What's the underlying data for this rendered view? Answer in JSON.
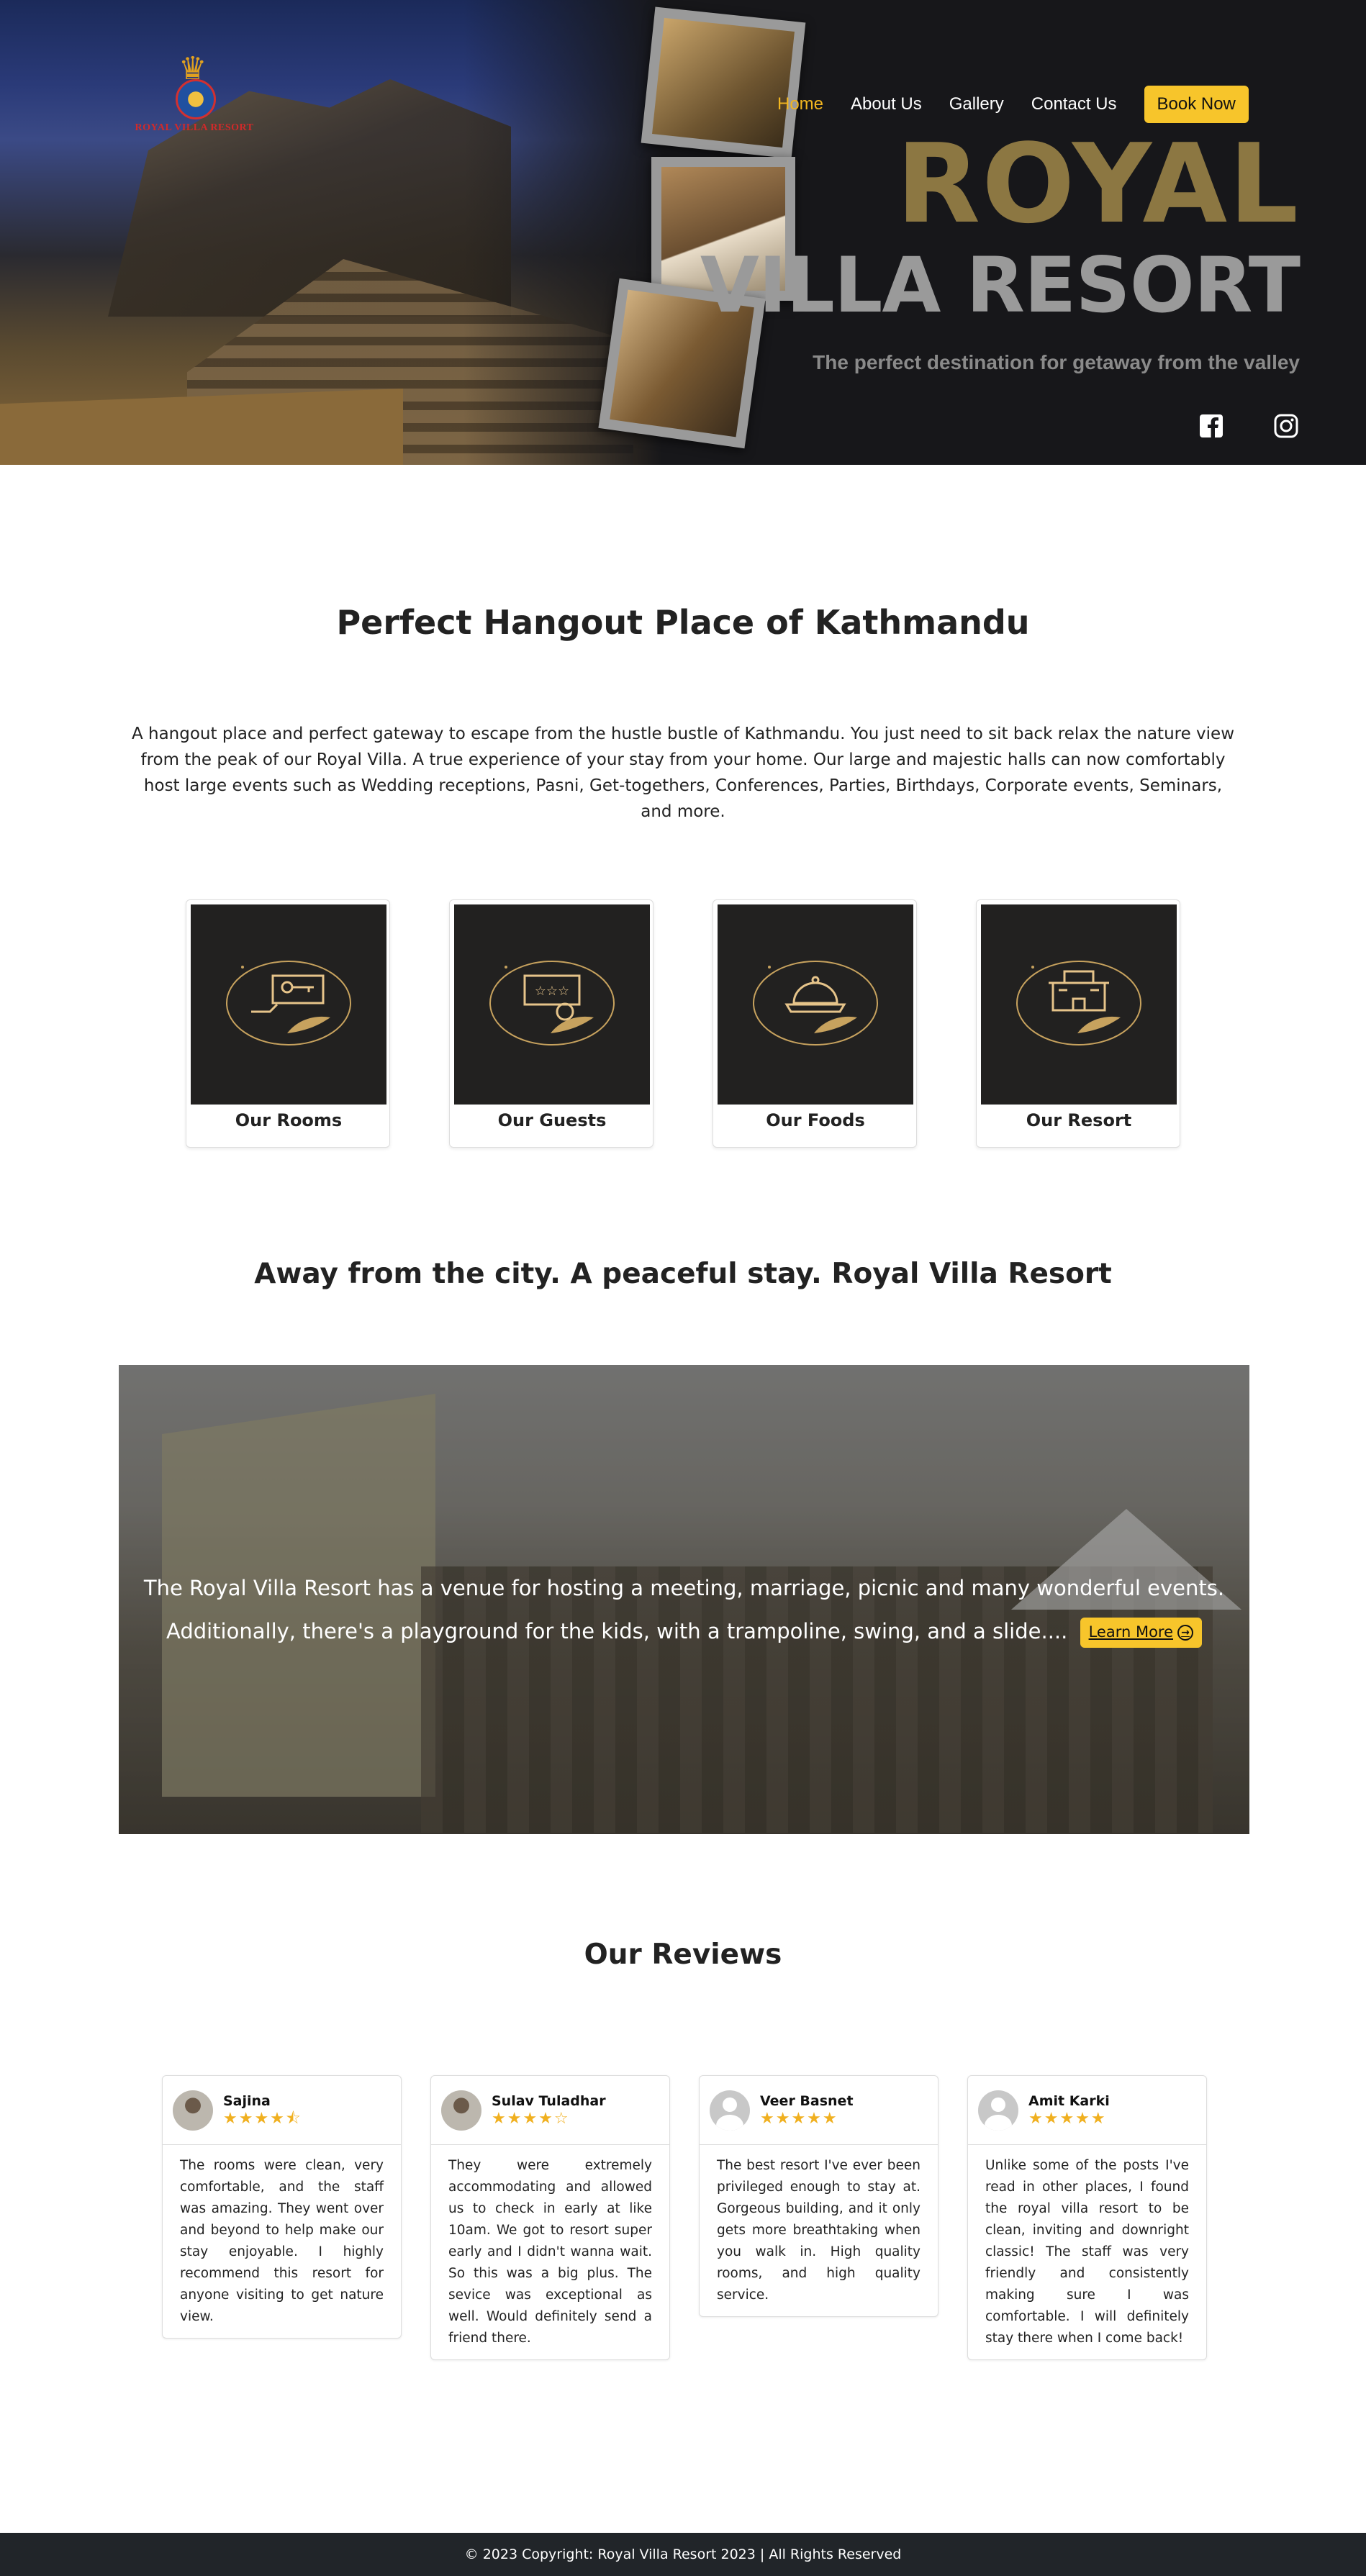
{
  "brand": {
    "logo_text": "ROYAL VILLA RESORT"
  },
  "nav": {
    "items": [
      "Home",
      "About Us",
      "Gallery",
      "Contact Us"
    ],
    "book_label": "Book Now"
  },
  "hero": {
    "title_line1": "ROYAL",
    "title_line2": "VILLA RESORT",
    "subtitle": "The perfect destination for getaway from the valley",
    "social": [
      "facebook-icon",
      "instagram-icon"
    ]
  },
  "intro": {
    "heading": "Perfect Hangout Place of Kathmandu",
    "text": "A hangout place and perfect gateway to escape from the hustle bustle of Kathmandu. You just need to sit back relax the nature view from the peak of our Royal Villa. A true experience of your stay from your home. Our large and majestic halls can now comfortably host large events such as Wedding receptions, Pasni, Get-togethers, Conferences, Parties, Birthdays, Corporate events, Seminars, and more."
  },
  "features": [
    {
      "label": "Our Rooms",
      "icon": "room-key-icon"
    },
    {
      "label": "Our Guests",
      "icon": "guest-rating-icon"
    },
    {
      "label": "Our Foods",
      "icon": "food-cloche-icon"
    },
    {
      "label": "Our Resort",
      "icon": "resort-building-icon"
    }
  ],
  "peaceful": {
    "heading": "Away from the city. A peaceful stay. Royal Villa Resort",
    "text": "The Royal Villa Resort has a venue for hosting a meeting, marriage, picnic and many wonderful events. Additionally, there's a playground for the kids, with a trampoline, swing, and a slide....",
    "button": "Learn More"
  },
  "reviews": {
    "heading": "Our Reviews",
    "items": [
      {
        "name": "Sajina",
        "stars": "★★★★⯪",
        "text": "The rooms were clean, very comfortable, and the staff was amazing. They went over and beyond to help make our stay enjoyable. I highly recommend this resort for anyone visiting to get nature view."
      },
      {
        "name": "Sulav Tuladhar",
        "stars": "★★★★☆",
        "text": "They were extremely accommodating and allowed us to check in early at like 10am. We got to resort super early and I didn't wanna wait. So this was a big plus. The sevice was exceptional as well. Would definitely send a friend there."
      },
      {
        "name": "Veer Basnet",
        "stars": "★★★★★",
        "text": "The best resort I've ever been privileged enough to stay at. Gorgeous building, and it only gets more breathtaking when you walk in. High quality rooms, and high quality service."
      },
      {
        "name": "Amit Karki",
        "stars": "★★★★★",
        "text": "Unlike some of the posts I've read in other places, I found the royal villa resort to be clean, inviting and downright classic! The staff was very friendly and consistently making sure I was comfortable. I will definitely stay there when I come back!"
      }
    ]
  },
  "footer": {
    "text": "© 2023 Copyright: Royal Villa Resort 2023 | All Rights Reserved"
  },
  "colors": {
    "accent": "#f7c52b",
    "gold": "#8c7742",
    "dark": "#17171a",
    "footer": "#212529"
  }
}
